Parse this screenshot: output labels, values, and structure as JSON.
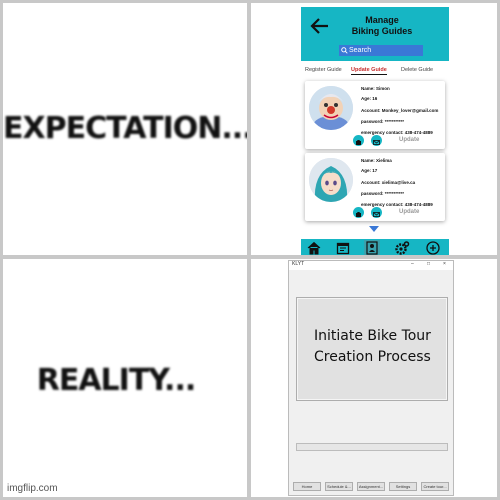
{
  "meme": {
    "top_caption": "EXPECTATION...",
    "bottom_caption": "REALITY...",
    "watermark": "imgflip.com"
  },
  "app": {
    "title_line1": "Manage",
    "title_line2": "Biking Guides",
    "search_placeholder": "Search",
    "tabs": [
      "Register Guide",
      "Update Guide",
      "Delete Guide"
    ],
    "active_tab": "Update Guide",
    "guides": [
      {
        "name": "Name: Simon",
        "age": "Age: 16",
        "account": "Account: Monkey_lover@gmail.com",
        "password": "password: ***********",
        "emergency": "emergency contact: 438-474-4889",
        "update_label": "Update"
      },
      {
        "name": "Name: Xielima",
        "age": "Age: 17",
        "account": "Account: xielima@live.ca",
        "password": "password: ***********",
        "emergency": "emergency contact: 438-474-4889",
        "update_label": "Update"
      }
    ],
    "nav_icons": [
      "home-icon",
      "calendar-icon",
      "guide-icon",
      "gear-icon",
      "plus-icon"
    ],
    "colors": {
      "header": "#16b6c4",
      "search": "#3a78d6",
      "active_tab": "#c62b2b"
    }
  },
  "window": {
    "title": "KLYT",
    "controls": [
      "–",
      "□",
      "×"
    ],
    "main_button_line1": "Initiate Bike Tour",
    "main_button_line2": "Creation Process",
    "progress": 0,
    "bottom_buttons": [
      "Home",
      "Schedule &...",
      "Assignment...",
      "Settings",
      "Create tour..."
    ]
  }
}
